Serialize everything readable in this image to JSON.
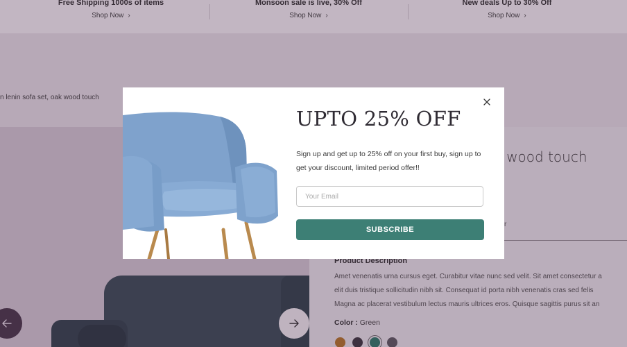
{
  "promos": [
    {
      "title": "Free Shipping 1000s of items",
      "link": "Shop Now"
    },
    {
      "title": "Monsoon sale is live, 30% Off",
      "link": "Shop Now"
    },
    {
      "title": "New deals Up to 30% Off",
      "link": "Shop Now"
    }
  ],
  "breadcrumb": "n lenin sofa set, oak wood touch",
  "product": {
    "title": "ak wood touch",
    "info_fragment": "r",
    "description_heading": "Product Description",
    "description_lines": [
      "Amet venenatis urna cursus eget. Curabitur vitae nunc sed velit. Sit amet consectetur a",
      "elit duis tristique sollicitudin nibh sit. Consequat id porta nibh venenatis cras sed felis",
      "Magna ac placerat vestibulum lectus mauris ultrices eros. Quisque sagittis purus sit an"
    ],
    "color_label": "Color :",
    "color_value": "Green",
    "swatches": [
      {
        "name": "orange",
        "color": "#b5772a",
        "selected": false
      },
      {
        "name": "charcoal",
        "color": "#3d3840",
        "selected": false
      },
      {
        "name": "green",
        "color": "#2e7a6a",
        "selected": true
      },
      {
        "name": "grey",
        "color": "#5e5a62",
        "selected": false
      }
    ]
  },
  "gallery": {
    "prev_icon": "arrow-left-icon",
    "next_icon": "arrow-right-icon"
  },
  "modal": {
    "headline": "UPTO 25% OFF",
    "text": "Sign up and get up to 25% off on your first buy, sign up to get your discount, limited period offer!!",
    "email_placeholder": "Your Email",
    "email_value": "",
    "subscribe_label": "SUBSCRIBE",
    "close_icon": "close-icon",
    "accent_color": "#3d7f75"
  }
}
